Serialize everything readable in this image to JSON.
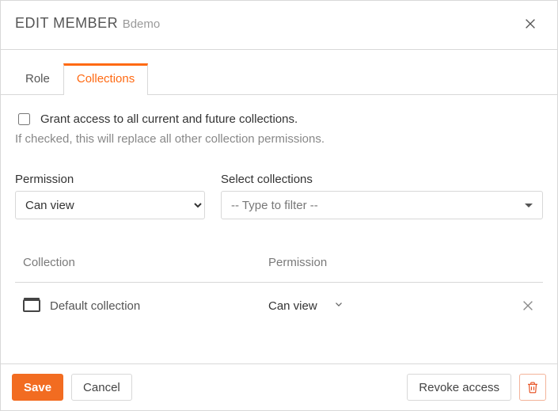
{
  "header": {
    "title_prefix": "EDIT MEMBER",
    "title_suffix": "Bdemo"
  },
  "tabs": {
    "role": "Role",
    "collections": "Collections",
    "active": "collections"
  },
  "grant": {
    "label": "Grant access to all current and future collections.",
    "hint": "If checked, this will replace all other collection permissions.",
    "checked": false
  },
  "fields": {
    "permission_label": "Permission",
    "permission_value": "Can view",
    "select_label": "Select collections",
    "select_placeholder": "-- Type to filter --"
  },
  "table": {
    "col1": "Collection",
    "col2": "Permission",
    "rows": [
      {
        "name": "Default collection",
        "permission": "Can view"
      }
    ]
  },
  "footer": {
    "save": "Save",
    "cancel": "Cancel",
    "revoke": "Revoke access"
  }
}
